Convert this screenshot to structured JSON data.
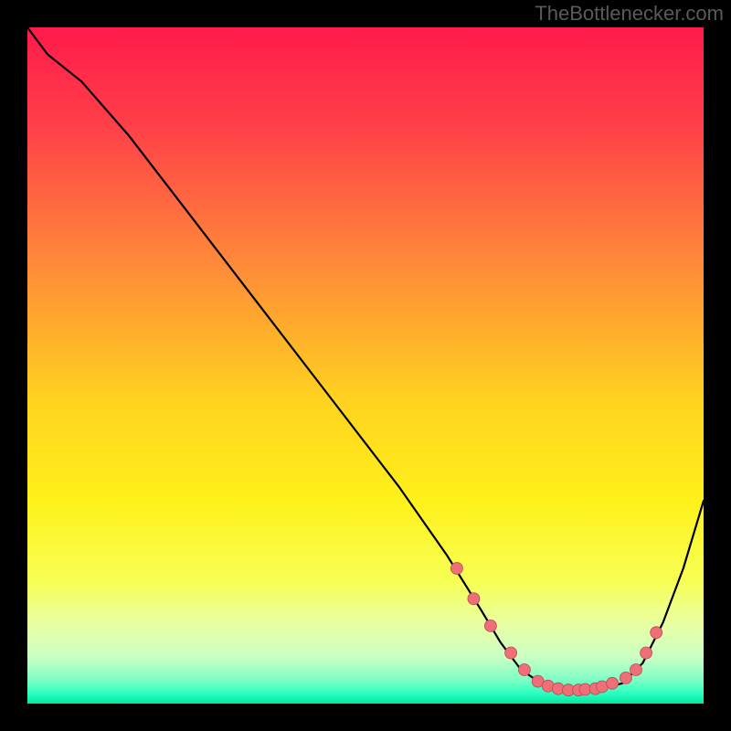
{
  "watermark": "TheBottlenecker.com",
  "colors": {
    "frame": "#000000",
    "watermark": "#5a5a5a",
    "curve": "#000000",
    "marker_fill": "#ef6f78",
    "marker_stroke": "#b84a52",
    "gradient_stops": [
      {
        "offset": 0.0,
        "color": "#ff1a4b"
      },
      {
        "offset": 0.15,
        "color": "#ff4148"
      },
      {
        "offset": 0.35,
        "color": "#ff8a39"
      },
      {
        "offset": 0.55,
        "color": "#ffd21f"
      },
      {
        "offset": 0.7,
        "color": "#fff11a"
      },
      {
        "offset": 0.82,
        "color": "#f7ff55"
      },
      {
        "offset": 0.88,
        "color": "#e9ffa0"
      },
      {
        "offset": 0.93,
        "color": "#ccffc4"
      },
      {
        "offset": 0.965,
        "color": "#7effc5"
      },
      {
        "offset": 0.985,
        "color": "#2bffc0"
      },
      {
        "offset": 1.0,
        "color": "#00e8a0"
      }
    ]
  },
  "chart_data": {
    "type": "line",
    "title": "",
    "xlabel": "",
    "ylabel": "",
    "xlim": [
      0,
      100
    ],
    "ylim": [
      0,
      100
    ],
    "grid": false,
    "series": [
      {
        "name": "curve",
        "x": [
          0,
          3,
          8,
          15,
          25,
          35,
          45,
          55,
          62,
          67,
          70,
          73,
          76,
          80,
          84,
          88,
          91,
          94,
          97,
          100
        ],
        "y": [
          100,
          96,
          92,
          84,
          71,
          58,
          45,
          32,
          22,
          14,
          9,
          5,
          3,
          2,
          2,
          3,
          6,
          12,
          20,
          30
        ]
      }
    ],
    "markers": {
      "name": "selected-points",
      "x": [
        63.5,
        66.0,
        68.5,
        71.5,
        73.5,
        75.5,
        77.0,
        78.5,
        80.0,
        81.5,
        82.5,
        84.0,
        85.0,
        86.5,
        88.5,
        90.0,
        91.5,
        93.0
      ],
      "y": [
        20.0,
        15.5,
        11.5,
        7.5,
        5.0,
        3.3,
        2.6,
        2.2,
        2.0,
        2.0,
        2.1,
        2.2,
        2.5,
        3.0,
        3.8,
        5.0,
        7.5,
        10.5
      ]
    }
  }
}
